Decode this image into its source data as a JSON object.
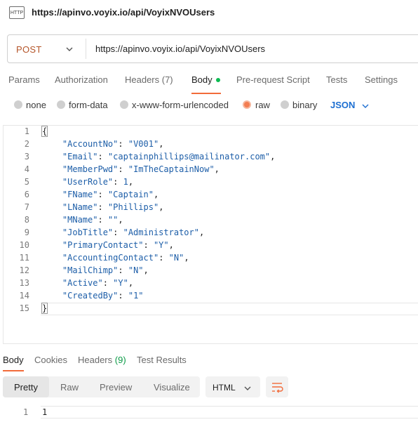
{
  "header": {
    "icon_text": "HTTP",
    "title": "https://apinvo.voyix.io/api/VoyixNVOUsers"
  },
  "request": {
    "method": "POST",
    "url": "https://apinvo.voyix.io/api/VoyixNVOUsers"
  },
  "tabs": [
    "Params",
    "Authorization",
    "Headers (7)",
    "Body",
    "Pre-request Script",
    "Tests",
    "Settings"
  ],
  "body_modes": [
    "none",
    "form-data",
    "x-www-form-urlencoded",
    "raw",
    "binary"
  ],
  "body_format": "JSON",
  "editor": {
    "line_numbers": [
      "1",
      "2",
      "3",
      "4",
      "5",
      "6",
      "7",
      "8",
      "9",
      "10",
      "11",
      "12",
      "13",
      "14",
      "15"
    ],
    "lines": [
      {
        "text": "{"
      },
      {
        "key": "\"AccountNo\"",
        "val": "\"V001\"",
        "tail": ","
      },
      {
        "key": "\"Email\"",
        "val": "\"captainphillips@mailinator.com\"",
        "tail": ","
      },
      {
        "key": "\"MemberPwd\"",
        "val": "\"ImTheCaptainNow\"",
        "tail": ","
      },
      {
        "key": "\"UserRole\"",
        "val": "1",
        "tail": ","
      },
      {
        "key": "\"FName\"",
        "val": "\"Captain\"",
        "tail": ","
      },
      {
        "key": "\"LName\"",
        "val": "\"Phillips\"",
        "tail": ","
      },
      {
        "key": "\"MName\"",
        "val": "\"\"",
        "tail": ","
      },
      {
        "key": "\"JobTitle\"",
        "val": "\"Administrator\"",
        "tail": ","
      },
      {
        "key": "\"PrimaryContact\"",
        "val": "\"Y\"",
        "tail": ","
      },
      {
        "key": "\"AccountingContact\"",
        "val": "\"N\"",
        "tail": ","
      },
      {
        "key": "\"MailChimp\"",
        "val": "\"N\"",
        "tail": ","
      },
      {
        "key": "\"Active\"",
        "val": "\"Y\"",
        "tail": ","
      },
      {
        "key": "\"CreatedBy\"",
        "val": "\"1\"",
        "tail": ""
      },
      {
        "text": "}"
      }
    ]
  },
  "response": {
    "tabs": [
      "Body",
      "Cookies",
      "Headers",
      "Test Results"
    ],
    "headers_count": "(9)",
    "views": [
      "Pretty",
      "Raw",
      "Preview",
      "Visualize"
    ],
    "format": "HTML",
    "line_no": "1",
    "content": "1"
  },
  "colors": {
    "accent": "#f26b3a",
    "method": "#b5562a",
    "link_blue": "#1d6fd1",
    "green_dot": "#0cbb52",
    "headers_count": "#0a9a46"
  }
}
